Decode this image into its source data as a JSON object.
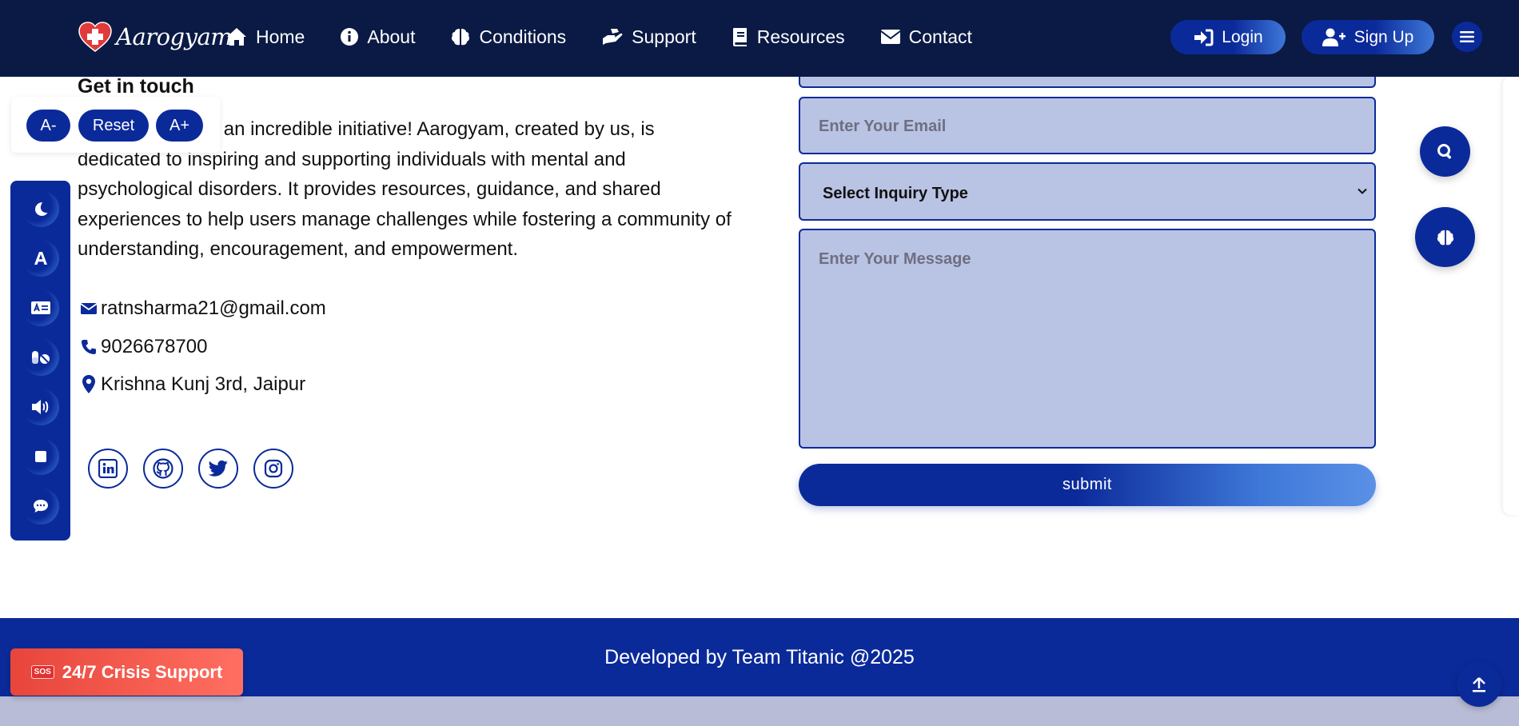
{
  "nav": {
    "brand": "Aarogyam",
    "links": [
      {
        "label": "Home",
        "icon": "home-icon"
      },
      {
        "label": "About",
        "icon": "info-icon"
      },
      {
        "label": "Conditions",
        "icon": "brain-icon"
      },
      {
        "label": "Support",
        "icon": "helping-hand-icon"
      },
      {
        "label": "Resources",
        "icon": "book-icon"
      },
      {
        "label": "Contact",
        "icon": "envelope-icon"
      }
    ],
    "login": "Login",
    "signup": "Sign Up"
  },
  "font_controls": {
    "decrease": "A-",
    "reset": "Reset",
    "increase": "A+"
  },
  "contact": {
    "heading": "Get in touch",
    "intro": "Aarogyam is like an incredible initiative! Aarogyam, created by us, is dedicated to inspiring and supporting individuals with mental and psychological disorders. It provides resources, guidance, and shared experiences to help users manage challenges while fostering a community of understanding, encouragement, and empowerment.",
    "email": "ratnsharma21@gmail.com",
    "phone": "9026678700",
    "address": "Krishna Kunj 3rd, Jaipur"
  },
  "form": {
    "email_placeholder": "Enter Your Email",
    "inquiry_selected": "Select Inquiry Type",
    "message_placeholder": "Enter Your Message",
    "submit": "submit"
  },
  "footer": {
    "credit": "Developed by Team Titanic @2025",
    "crisis_badge": "SOS",
    "crisis_label": "24/7 Crisis Support"
  },
  "theme": {
    "navy": "#0a1a45",
    "primary": "#0b2a9a",
    "field_bg": "#b9c3e4",
    "crisis": "#e8453b"
  }
}
